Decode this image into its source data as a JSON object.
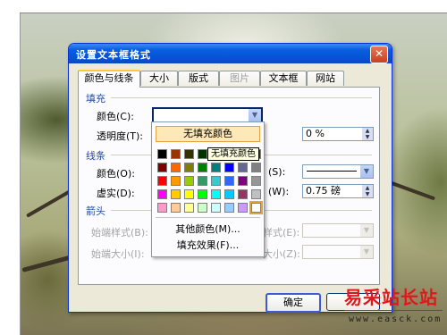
{
  "dialog": {
    "title": "设置文本框格式",
    "close_symbol": "✕",
    "tabs": [
      {
        "label": "颜色与线条",
        "active": true,
        "enabled": true
      },
      {
        "label": "大小",
        "active": false,
        "enabled": true
      },
      {
        "label": "版式",
        "active": false,
        "enabled": true
      },
      {
        "label": "图片",
        "active": false,
        "enabled": false
      },
      {
        "label": "文本框",
        "active": false,
        "enabled": true
      },
      {
        "label": "网站",
        "active": false,
        "enabled": true
      }
    ],
    "fill": {
      "section_label": "填充",
      "color_label": "颜色(C):",
      "color_value": "",
      "transparency_label": "透明度(T):",
      "transparency_value": "0 %"
    },
    "line": {
      "section_label": "线条",
      "color_label": "颜色(O):",
      "style_label_suffix": "(S):",
      "dash_label": "虚实(D):",
      "weight_label_suffix": "(W):",
      "weight_value": "0.75 磅"
    },
    "arrows": {
      "section_label": "箭头",
      "begin_style_label": "始端样式(B):",
      "begin_size_label": "始端大小(I):",
      "end_style_label_suffix": "样式(E):",
      "end_size_label_suffix": "大小(Z):"
    },
    "ok_label": "确定"
  },
  "color_popup": {
    "no_fill_label": "无填充颜色",
    "tooltip": "无填充颜色",
    "more_colors_label": "其他颜色(M)...",
    "fill_effects_label": "填充效果(F)...",
    "swatch_rows": [
      [
        "#000000",
        "#993300",
        "#333300",
        "#003300",
        "#003366",
        "#000080",
        "#333399",
        "#333333"
      ],
      [
        "#800000",
        "#ff6600",
        "#808000",
        "#008000",
        "#008080",
        "#0000ff",
        "#666699",
        "#808080"
      ],
      [
        "#ff0000",
        "#ff9900",
        "#99cc00",
        "#339966",
        "#33cccc",
        "#3366ff",
        "#800080",
        "#969696"
      ],
      [
        "#ff00ff",
        "#ffcc00",
        "#ffff00",
        "#00ff00",
        "#00ffff",
        "#00ccff",
        "#993366",
        "#c0c0c0"
      ],
      [
        "#ff99cc",
        "#ffcc99",
        "#ffff99",
        "#ccffcc",
        "#ccffff",
        "#99ccff",
        "#cc99ff",
        "#ffffff"
      ]
    ]
  },
  "watermark": {
    "site_name": "易采站长站",
    "url": "www.easck.com"
  }
}
